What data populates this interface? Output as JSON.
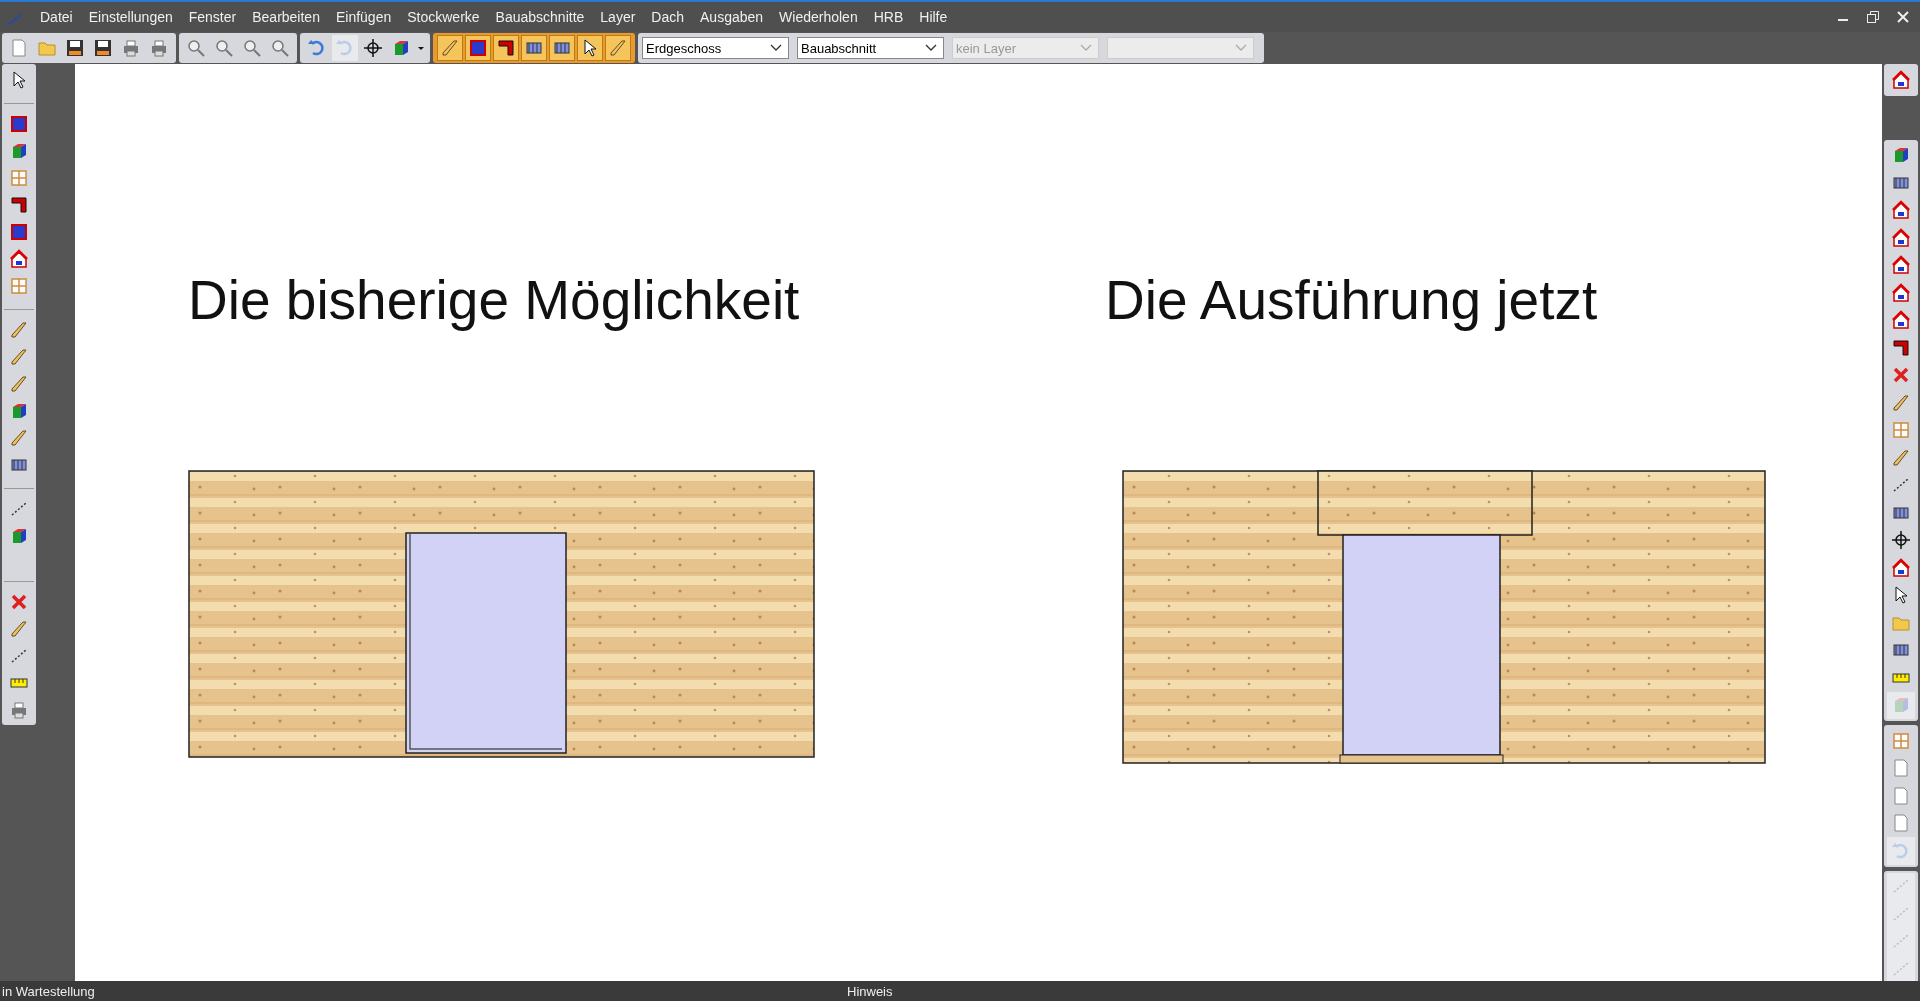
{
  "menu": [
    "Datei",
    "Einstellungen",
    "Fenster",
    "Bearbeiten",
    "Einfügen",
    "Stockwerke",
    "Bauabschnitte",
    "Layer",
    "Dach",
    "Ausgaben",
    "Wiederholen",
    "HRB",
    "Hilfe"
  ],
  "toolbar": {
    "buttons": [
      {
        "disabled": false
      },
      {
        "disabled": false
      },
      {
        "disabled": false
      },
      {
        "disabled": false
      },
      {
        "disabled": false
      },
      {
        "disabled": false
      },
      {
        "disabled": false
      },
      {
        "disabled": false
      },
      {
        "disabled": false
      },
      {
        "disabled": false
      },
      {
        "disabled": false
      },
      {
        "disabled": true
      },
      {
        "disabled": false
      },
      {
        "disabled": false
      },
      {
        "disabled": false
      },
      {
        "disabled": false
      },
      {
        "disabled": false
      },
      {
        "disabled": false
      },
      {
        "disabled": false
      },
      {
        "disabled": false
      },
      {
        "disabled": false
      }
    ],
    "dropdowns": [
      {
        "value": "Erdgeschoss",
        "disabled": false
      },
      {
        "value": "Bauabschnitt",
        "disabled": false
      },
      {
        "value": "kein Layer",
        "disabled": true
      },
      {
        "disabled": true
      }
    ]
  },
  "right_toolbar": {
    "buttons": [
      {
        "disabled": false
      },
      {
        "disabled": false
      },
      {
        "disabled": false
      },
      {
        "disabled": false
      },
      {
        "disabled": false
      },
      {
        "disabled": false
      },
      {
        "disabled": false
      },
      {
        "disabled": false
      },
      {
        "disabled": false
      },
      {
        "disabled": false
      },
      {
        "disabled": false
      },
      {
        "disabled": false
      },
      {
        "disabled": false
      },
      {
        "disabled": false
      },
      {
        "disabled": false
      },
      {
        "disabled": false
      },
      {
        "disabled": false
      },
      {
        "disabled": false
      },
      {
        "disabled": false
      },
      {
        "disabled": false
      },
      {
        "disabled": false
      },
      {
        "disabled": true
      },
      {
        "disabled": false
      },
      {
        "disabled": false
      },
      {
        "disabled": false
      },
      {
        "disabled": false
      },
      {
        "disabled": true
      },
      {
        "disabled": true
      },
      {
        "disabled": true
      },
      {
        "disabled": true
      },
      {
        "disabled": true
      }
    ]
  },
  "panels": [
    {
      "title": "Die bisherige Möglichkeit",
      "kind": "opening"
    },
    {
      "title": "Die Ausführung jetzt",
      "kind": "lintel"
    }
  ],
  "status_bar": {
    "left": "in Wartestellung",
    "center": "Hinweis"
  }
}
